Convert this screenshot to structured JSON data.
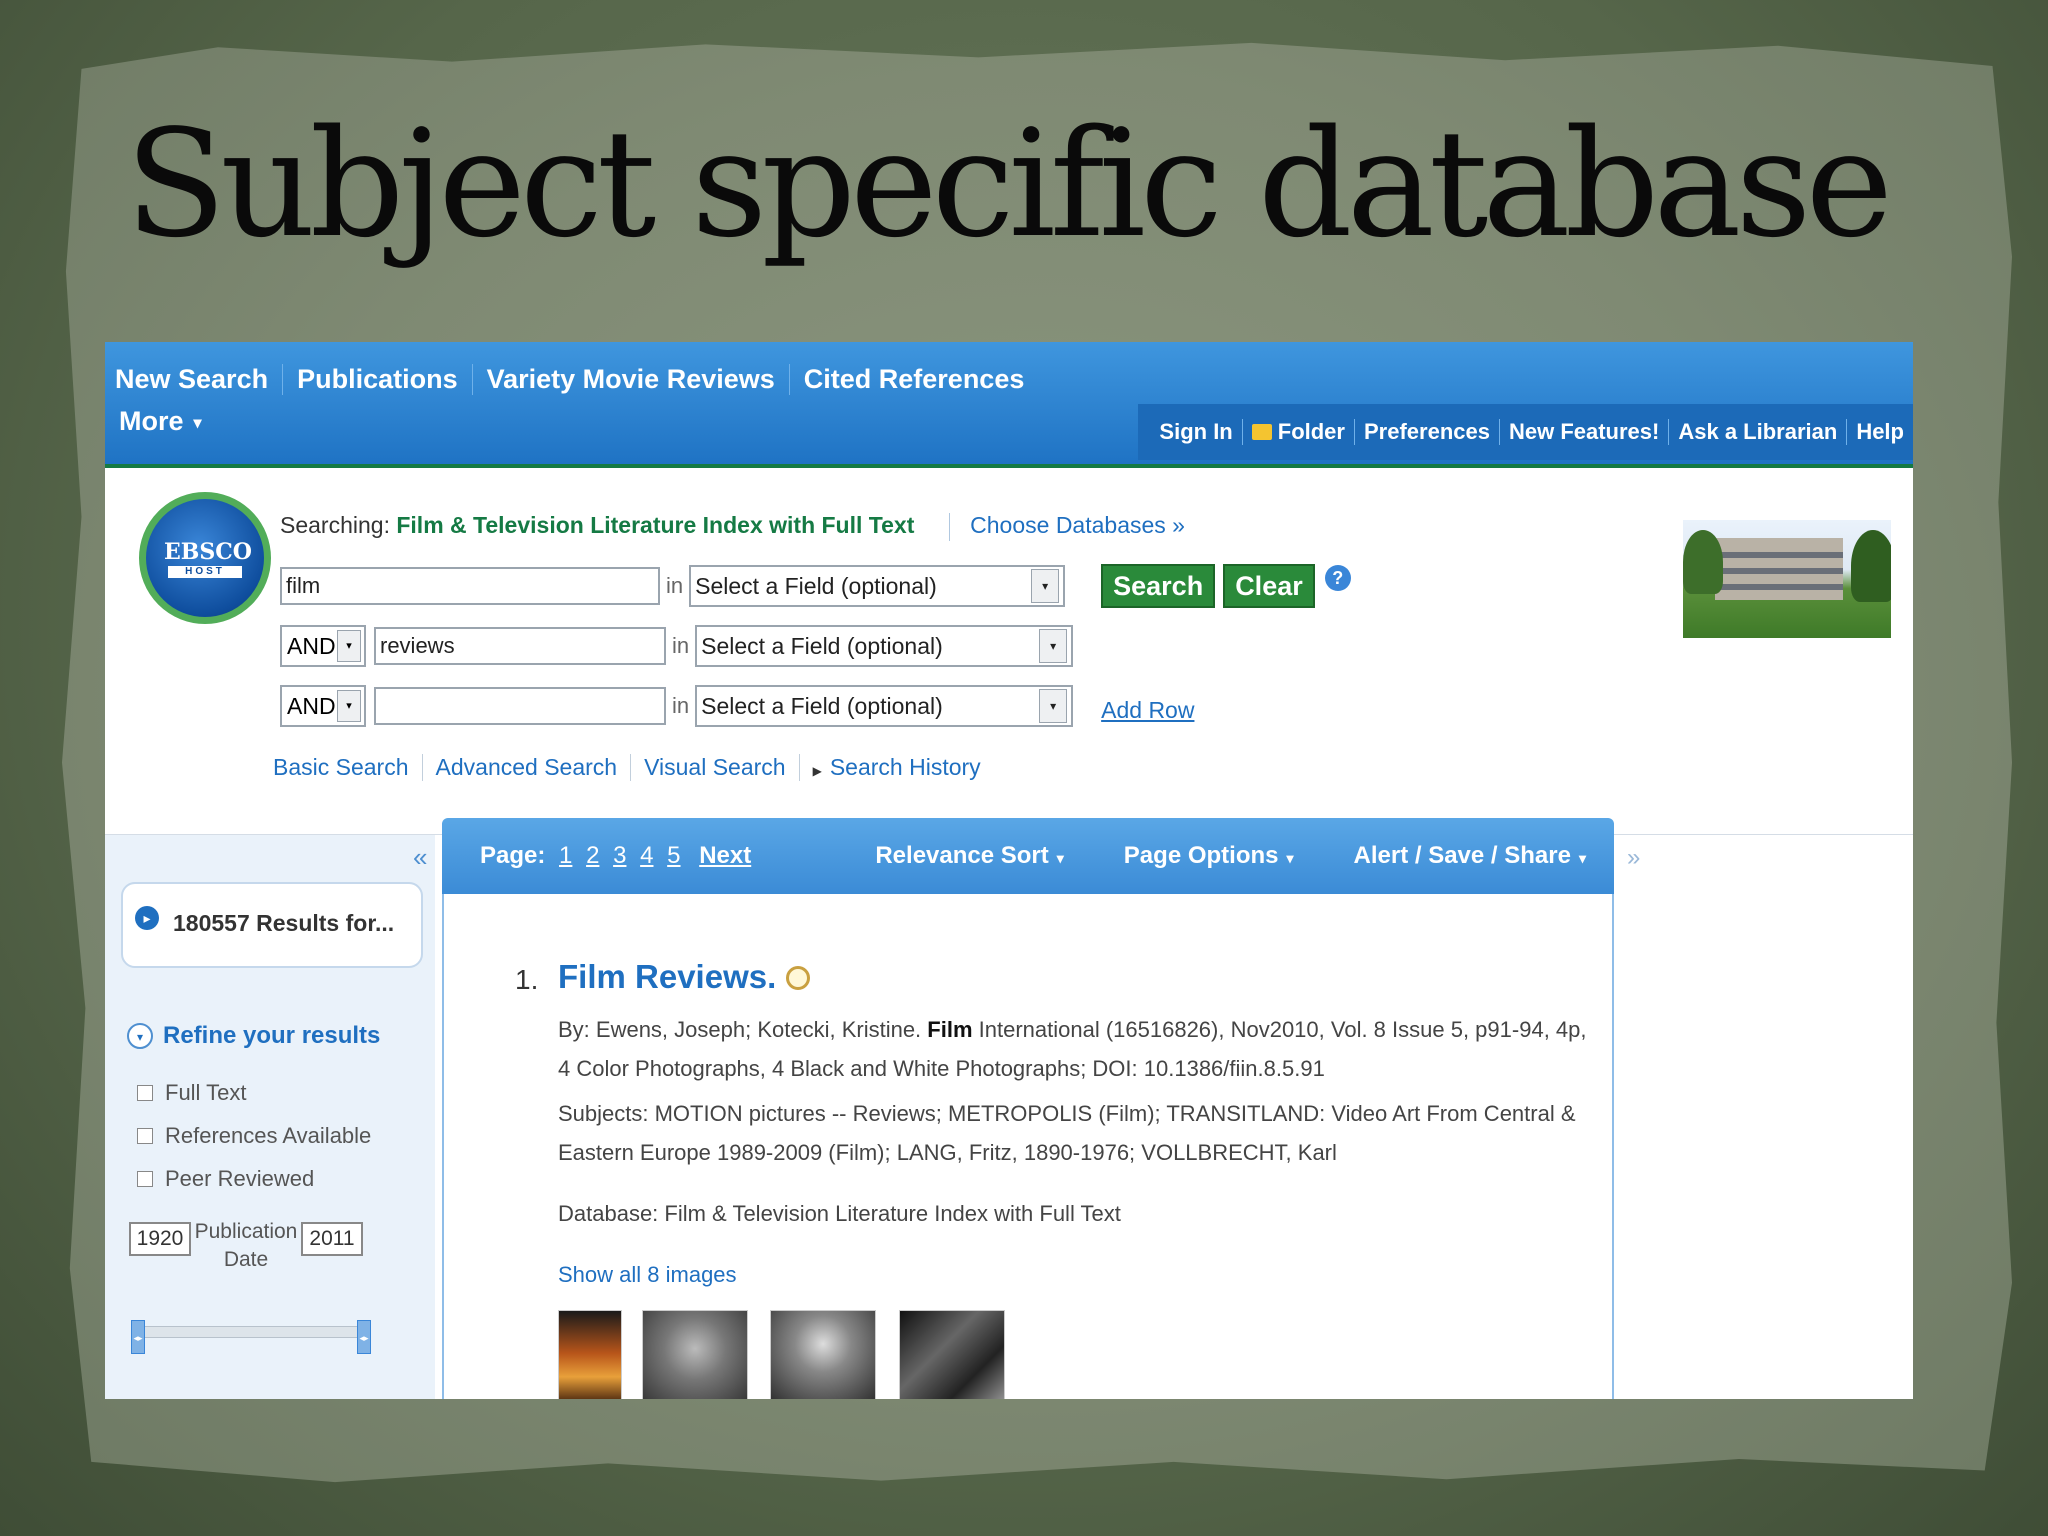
{
  "slide_title": "Subject specific database",
  "topnav": {
    "items": [
      "New Search",
      "Publications",
      "Variety Movie Reviews",
      "Cited References"
    ],
    "more": "More",
    "right": [
      "Sign In",
      "Folder",
      "Preferences",
      "New Features!",
      "Ask a Librarian",
      "Help"
    ]
  },
  "logo": {
    "line1": "EBSCO",
    "line2": "HOST"
  },
  "search": {
    "searching_label": "Searching:",
    "database": "Film & Television Literature Index with Full Text",
    "choose_db": "Choose Databases »",
    "in_label": "in",
    "rows": [
      {
        "term": "film",
        "field": "Select a Field (optional)"
      },
      {
        "bool": "AND",
        "term": "reviews",
        "field": "Select a Field (optional)"
      },
      {
        "bool": "AND",
        "term": "",
        "field": "Select a Field (optional)"
      }
    ],
    "search_btn": "Search",
    "clear_btn": "Clear",
    "help": "?",
    "add_row": "Add Row",
    "links": [
      "Basic Search",
      "Advanced Search",
      "Visual Search",
      "Search History"
    ]
  },
  "left": {
    "results_count": "180557 Results for...",
    "refine": "Refine your results",
    "checkboxes": [
      "Full Text",
      "References Available",
      "Peer Reviewed"
    ],
    "pub_from": "1920",
    "pub_to": "2011",
    "pub_label_1": "Publication",
    "pub_label_2": "Date"
  },
  "resultsbar": {
    "page_label": "Page:",
    "pages": [
      "1",
      "2",
      "3",
      "4",
      "5"
    ],
    "next": "Next",
    "relevance": "Relevance Sort",
    "page_options": "Page Options",
    "alert": "Alert / Save / Share"
  },
  "result": {
    "number": "1.",
    "title": "Film Reviews.",
    "by_prefix": "By: Ewens, Joseph; Kotecki, Kristine. ",
    "by_bold": "Film",
    "by_suffix": " International (16516826), Nov2010, Vol. 8 Issue 5, p91-94, 4p,",
    "line2": "4 Color Photographs, 4 Black and White Photographs; DOI: 10.1386/fiin.8.5.91",
    "subjects1": "Subjects: MOTION pictures -- Reviews; METROPOLIS (Film); TRANSITLAND: Video Art From Central &",
    "subjects2": "Eastern Europe 1989-2009 (Film); LANG, Fritz, 1890-1976; VOLLBRECHT, Karl",
    "database": "Database: Film & Television Literature Index with Full Text",
    "show_images": "Show all 8 images"
  }
}
